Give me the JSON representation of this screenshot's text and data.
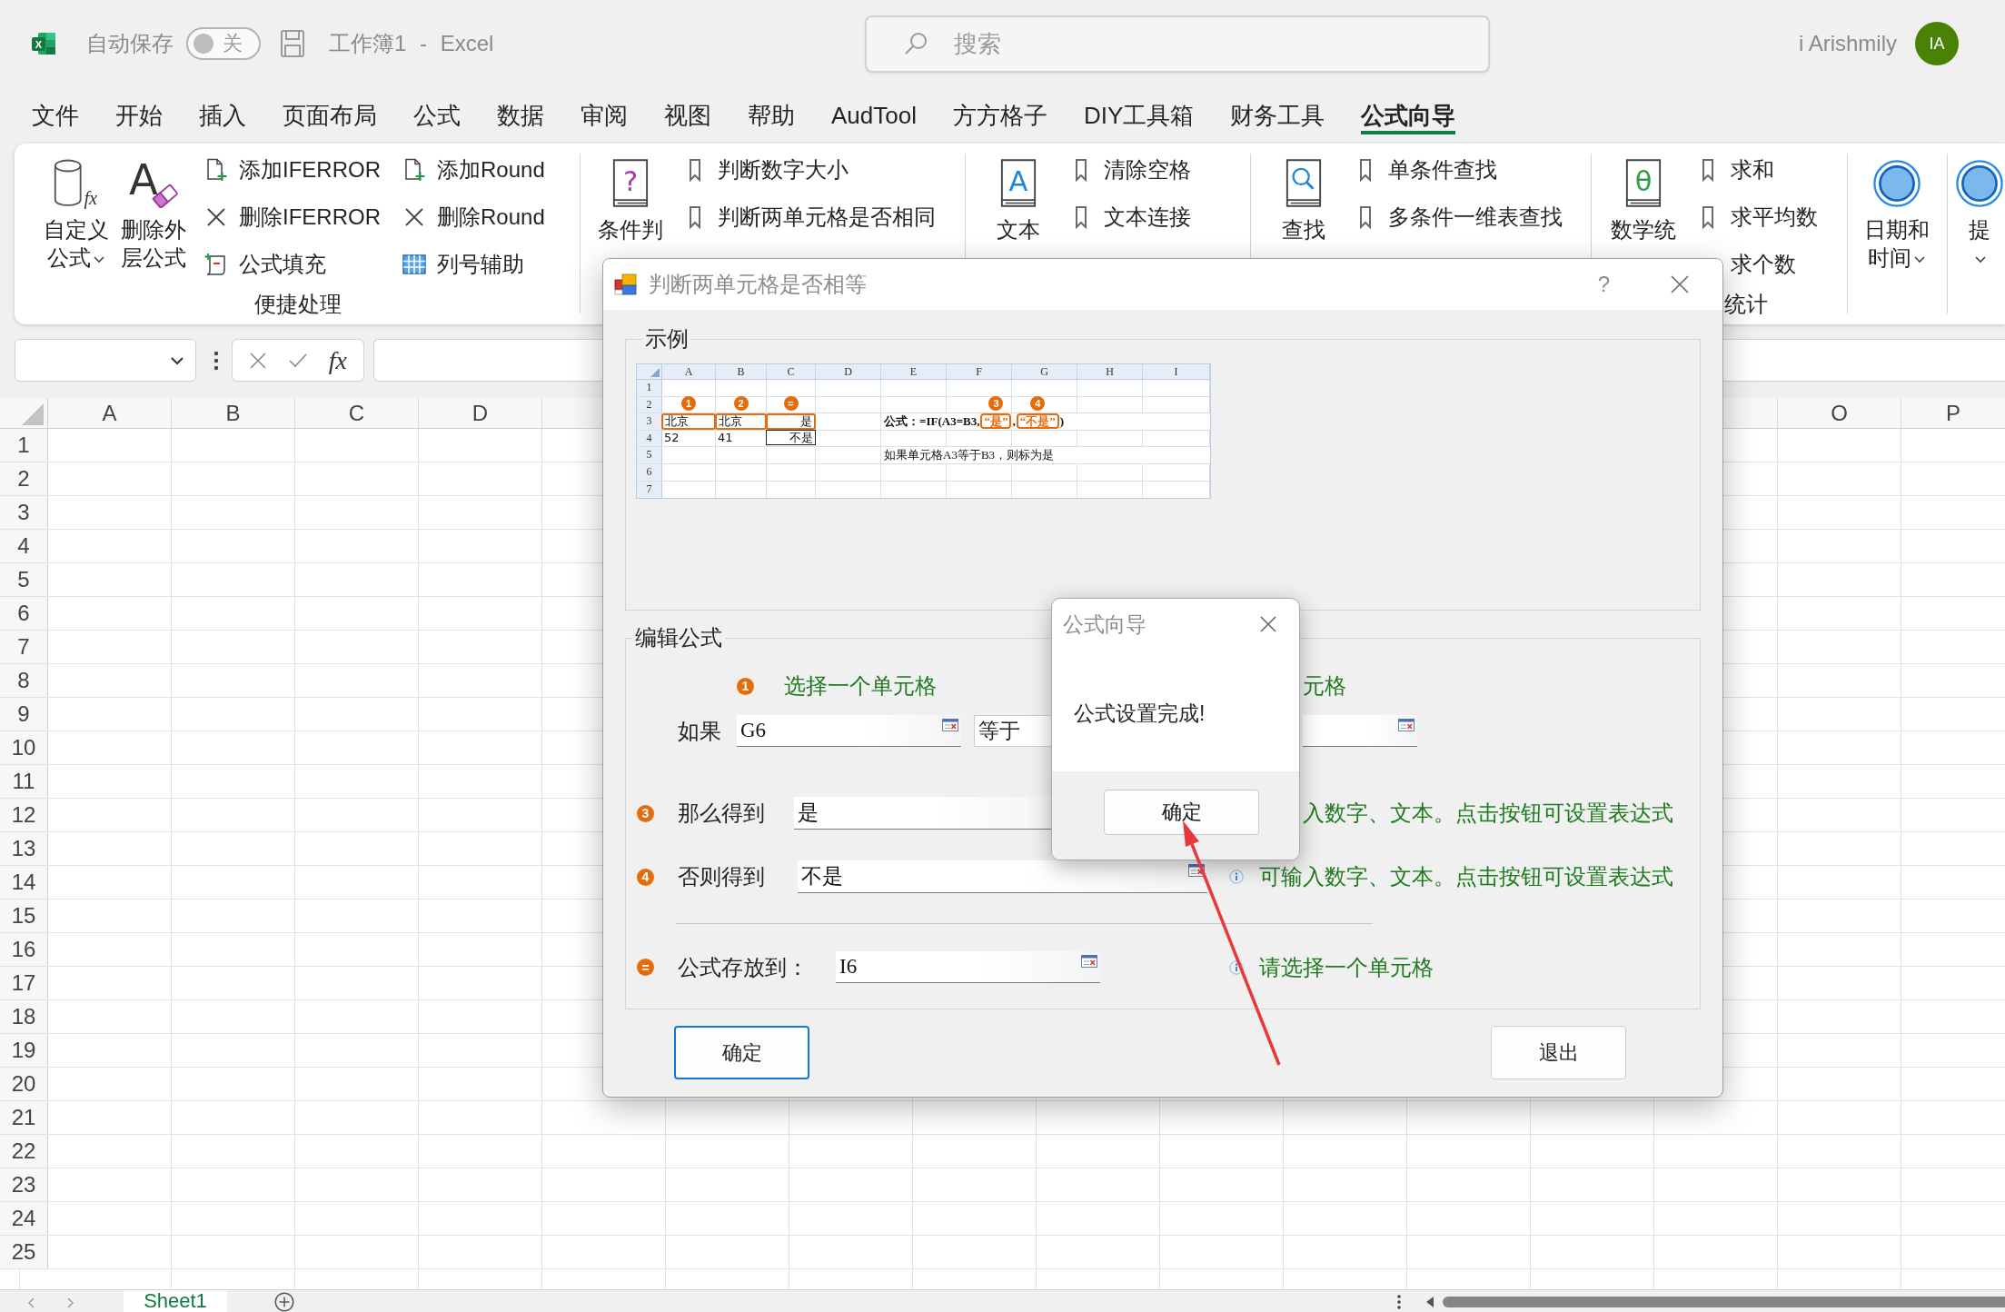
{
  "title_bar": {
    "logo_letter": "X",
    "autosave_label": "自动保存",
    "autosave_on": false,
    "autosave_state_text": "关",
    "document_title": "工作簿1 - Excel",
    "search_placeholder": "搜索",
    "user_name": "i Arishmily",
    "avatar_initials": "IA"
  },
  "menu_tabs": [
    {
      "label": "文件",
      "selected": false
    },
    {
      "label": "开始",
      "selected": false
    },
    {
      "label": "插入",
      "selected": false
    },
    {
      "label": "页面布局",
      "selected": false
    },
    {
      "label": "公式",
      "selected": false
    },
    {
      "label": "数据",
      "selected": false
    },
    {
      "label": "审阅",
      "selected": false
    },
    {
      "label": "视图",
      "selected": false
    },
    {
      "label": "帮助",
      "selected": false
    },
    {
      "label": "AudTool",
      "selected": false
    },
    {
      "label": "方方格子",
      "selected": false
    },
    {
      "label": "DIY工具箱",
      "selected": false
    },
    {
      "label": "财务工具",
      "selected": false
    },
    {
      "label": "公式向导",
      "selected": true
    }
  ],
  "ribbon": {
    "groups": [
      {
        "label": "便捷处理",
        "large": [
          {
            "label": "自定义公式",
            "kind": "cylinder",
            "glyph": "fx",
            "dropdown": true
          },
          {
            "label": "删除外层公式",
            "kind": "eraser",
            "glyph": "A",
            "dropdown": false
          }
        ],
        "columns": [
          [
            {
              "label": "添加IFERROR",
              "kind": "doc-plus"
            },
            {
              "label": "删除IFERROR",
              "kind": "cross"
            },
            {
              "label": "公式填充",
              "kind": "fill"
            }
          ],
          [
            {
              "label": "添加Round",
              "kind": "doc-plus"
            },
            {
              "label": "删除Round",
              "kind": "cross"
            },
            {
              "label": "列号辅助",
              "kind": "table"
            }
          ]
        ]
      },
      {
        "large": [
          {
            "label": "条件判",
            "kind": "book-question",
            "glyph": "?",
            "dropdown": false
          }
        ],
        "columns": [
          [
            {
              "label": "判断数字大小",
              "kind": "bookmark"
            },
            {
              "label": "判断两单元格是否相同",
              "kind": "bookmark"
            }
          ]
        ]
      },
      {
        "large": [
          {
            "label": "文本",
            "kind": "book-letter",
            "glyph": "A",
            "dropdown": false
          }
        ],
        "columns": [
          [
            {
              "label": "清除空格",
              "kind": "bookmark"
            },
            {
              "label": "文本连接",
              "kind": "bookmark"
            }
          ]
        ]
      },
      {
        "large": [
          {
            "label": "查找",
            "kind": "book-search",
            "dropdown": false
          }
        ],
        "columns": [
          [
            {
              "label": "单条件查找",
              "kind": "bookmark"
            },
            {
              "label": "多条件一维表查找",
              "kind": "bookmark"
            }
          ]
        ]
      },
      {
        "label": "统计",
        "large": [
          {
            "label": "数学统",
            "kind": "book-theta",
            "glyph": "θ",
            "dropdown": false
          }
        ],
        "columns": [
          [
            {
              "label": "求和",
              "kind": "bookmark"
            },
            {
              "label": "求平均数",
              "kind": "bookmark"
            },
            {
              "label": "求个数"
            }
          ]
        ]
      },
      {
        "large": [
          {
            "label": "日期和时间",
            "kind": "ring",
            "dropdown": true
          }
        ]
      },
      {
        "large": [
          {
            "label": "提",
            "kind": "ring",
            "dropdown": true
          }
        ]
      }
    ]
  },
  "formula_bar": {
    "function_label": "fx"
  },
  "sheet": {
    "column_headers_left": [
      "A",
      "B",
      "C",
      "D"
    ],
    "column_headers_right": [
      "O",
      "P"
    ],
    "row_numbers": [
      "1",
      "2",
      "3",
      "4",
      "5",
      "6",
      "7",
      "8",
      "9",
      "10",
      "11",
      "12",
      "13",
      "14",
      "15",
      "16",
      "17",
      "18",
      "19",
      "20",
      "21",
      "22",
      "23",
      "24",
      "25"
    ]
  },
  "sheet_tabs": [
    {
      "label": "Sheet1",
      "selected": true
    }
  ],
  "dialog": {
    "title": "判断两单元格是否相等",
    "help_glyph": "?",
    "example": {
      "label": "示例",
      "columns": [
        "A",
        "B",
        "C",
        "D",
        "E",
        "F",
        "G",
        "H",
        "I"
      ],
      "rows": [
        {
          "number": "1"
        },
        {
          "number": "2"
        },
        {
          "number": "3",
          "cells": [
            {
              "text": "北京",
              "kind": "text",
              "highlighted": true,
              "marker": "1"
            },
            {
              "text": "北京",
              "kind": "text",
              "highlighted": true,
              "marker": "2"
            },
            {
              "text": "是",
              "kind": "result",
              "highlighted": true,
              "marker": "="
            }
          ],
          "note": {
            "kind": "formula",
            "parts": [
              {
                "text": "公式：=IF(A3=B3,",
                "highlighted": false
              },
              {
                "text": "“是”",
                "highlighted": true,
                "marker": "3"
              },
              {
                "text": ",",
                "highlighted": false
              },
              {
                "text": "“不是”",
                "highlighted": true,
                "marker": "4"
              },
              {
                "text": ")",
                "highlighted": false
              }
            ]
          }
        },
        {
          "number": "4",
          "cells": [
            {
              "text": "52",
              "kind": "text",
              "highlighted": false
            },
            {
              "text": "41",
              "kind": "text",
              "highlighted": false
            },
            {
              "text": "不是",
              "kind": "result",
              "highlighted": false
            }
          ]
        },
        {
          "number": "5",
          "note": {
            "kind": "caption",
            "parts": [
              {
                "text": "如果单元格A3等于B3，则标为是",
                "highlighted": false
              }
            ]
          }
        },
        {
          "number": "6"
        },
        {
          "number": "7"
        }
      ]
    },
    "edit": {
      "label": "编辑公式",
      "hint_marker": "1",
      "hint": "选择一个单元格",
      "second_hint": "元格",
      "condition_label": "如果",
      "left_value": "G6",
      "operator": "等于",
      "rows": [
        {
          "kind": "result",
          "marker": "3",
          "label": "那么得到",
          "value": "是",
          "picker": false,
          "info": false,
          "hint": "入数字、文本。点击按钮可设置表达式"
        },
        {
          "kind": "result",
          "marker": "4",
          "label": "否则得到",
          "value": "不是",
          "picker": true,
          "info": true,
          "hint": "可输入数字、文本。点击按钮可设置表达式"
        },
        {
          "kind": "target",
          "marker": "=",
          "label": "公式存放到：",
          "value": "I6",
          "picker": true,
          "info": true,
          "hint": "请选择一个单元格"
        }
      ]
    },
    "buttons": [
      {
        "label": "确定",
        "kind": "default"
      },
      {
        "label": "退出",
        "kind": "normal"
      }
    ]
  },
  "message_box": {
    "title": "公式向导",
    "message": "公式设置完成!",
    "button": "确定"
  }
}
